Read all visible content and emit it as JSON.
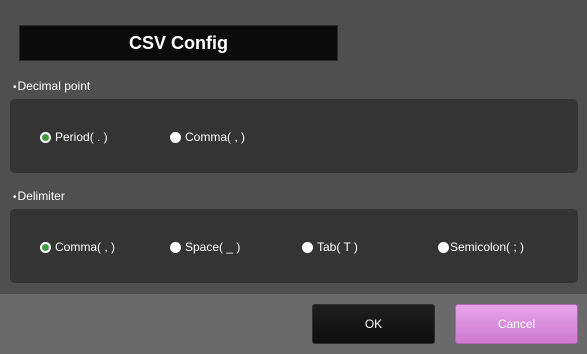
{
  "dialog": {
    "title": "CSV Config"
  },
  "decimal_point": {
    "label": "Decimal point",
    "options": [
      {
        "label": "Period( . )",
        "checked": true
      },
      {
        "label": "Comma( , )",
        "checked": false
      }
    ]
  },
  "delimiter": {
    "label": "Delimiter",
    "options": [
      {
        "label": "Comma( , )",
        "checked": true
      },
      {
        "label": "Space( _ )",
        "checked": false
      },
      {
        "label": "Tab( T )",
        "checked": false
      },
      {
        "label": "Semicolon( ; )",
        "checked": false
      }
    ]
  },
  "buttons": {
    "ok_label": "OK",
    "cancel_label": "Cancel"
  },
  "colors": {
    "radio_checked": "#3f9b3f",
    "cancel_button": "#cc79cf",
    "ok_button": "#0e0e0e"
  }
}
